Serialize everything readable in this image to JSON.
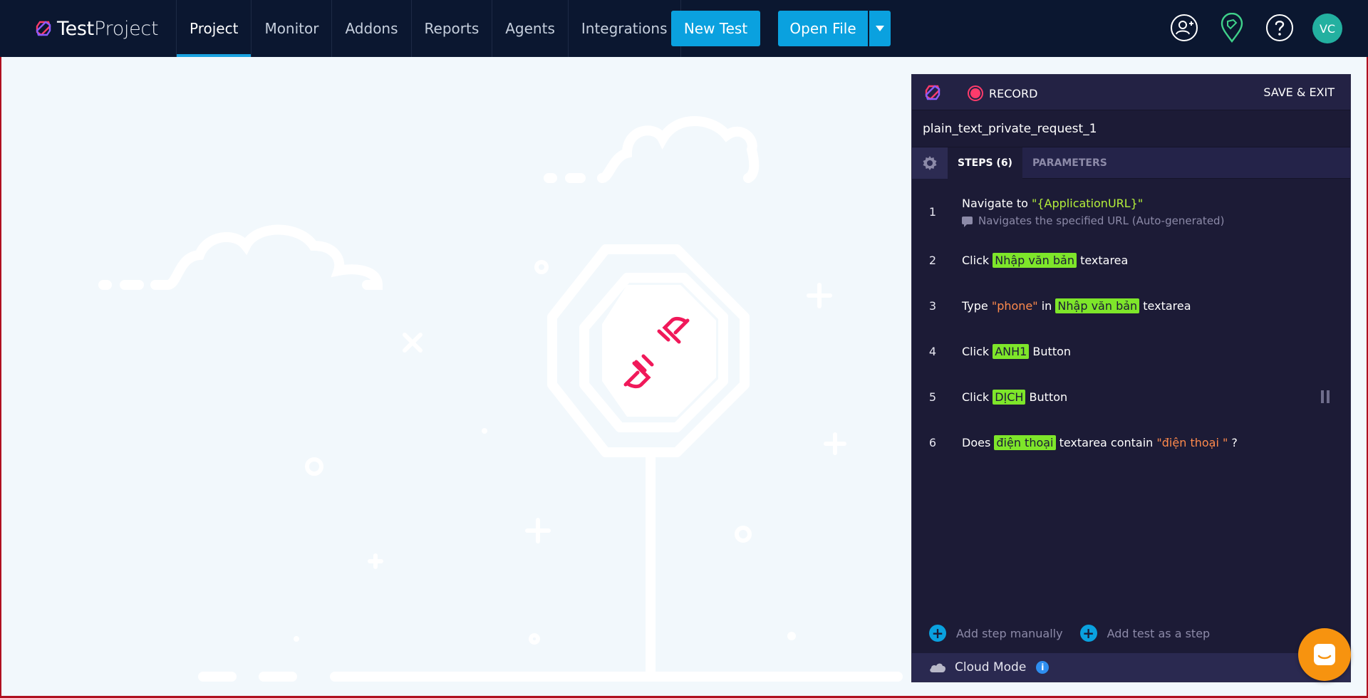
{
  "app": {
    "logo_text_bold": "Test",
    "logo_text_light": "Project"
  },
  "nav": {
    "items": [
      {
        "label": "Project",
        "active": true
      },
      {
        "label": "Monitor",
        "active": false
      },
      {
        "label": "Addons",
        "active": false
      },
      {
        "label": "Reports",
        "active": false
      },
      {
        "label": "Agents",
        "active": false
      },
      {
        "label": "Integrations",
        "active": false
      }
    ],
    "new_test_label": "New Test",
    "open_file_label": "Open File",
    "avatar_initials": "VC"
  },
  "icons": {
    "user": "add-user-icon",
    "pin": "location-pin-icon",
    "help": "help-icon",
    "caret": "chevron-down-icon",
    "settings": "gear-icon",
    "cloud": "cloud-icon",
    "info": "info-icon",
    "chat": "chat-icon",
    "unplugged": "unplugged-icon"
  },
  "recorder": {
    "record_label": "RECORD",
    "save_exit_label": "SAVE & EXIT",
    "test_name": "plain_text_private_request_1",
    "tabs": {
      "steps": "STEPS (6)",
      "parameters": "PARAMETERS"
    },
    "steps": [
      {
        "num": "1",
        "pre": "Navigate to ",
        "var": "\"{ApplicationURL}\"",
        "sub": "Navigates the specified URL (Auto-generated)"
      },
      {
        "num": "2",
        "pre": "Click ",
        "hl": "Nhập văn bản",
        "post": " textarea"
      },
      {
        "num": "3",
        "pre": "Type ",
        "str": "\"phone\"",
        "mid": " in ",
        "hl": "Nhập văn bản",
        "post": " textarea"
      },
      {
        "num": "4",
        "pre": "Click ",
        "hl": "ANH1",
        "post": " Button"
      },
      {
        "num": "5",
        "pre": "Click ",
        "hl": "DỊCH",
        "post": " Button"
      },
      {
        "num": "6",
        "pre": "Does ",
        "hl": "điện thoại",
        "mid": " textarea contain ",
        "str": "\"điện thoại \"",
        "post": " ?"
      }
    ],
    "add_step_label": "Add step manually",
    "add_test_label": "Add test as a step",
    "footer_label": "Cloud Mode",
    "info_glyph": "i"
  },
  "colors": {
    "nav_bg": "#0b1730",
    "accent": "#0aa1df",
    "panel_bg": "#1c1b36",
    "highlight": "#7ee62a",
    "record": "#ff3b6b",
    "string": "#ff8a4c",
    "launcher": "#f7930f"
  }
}
